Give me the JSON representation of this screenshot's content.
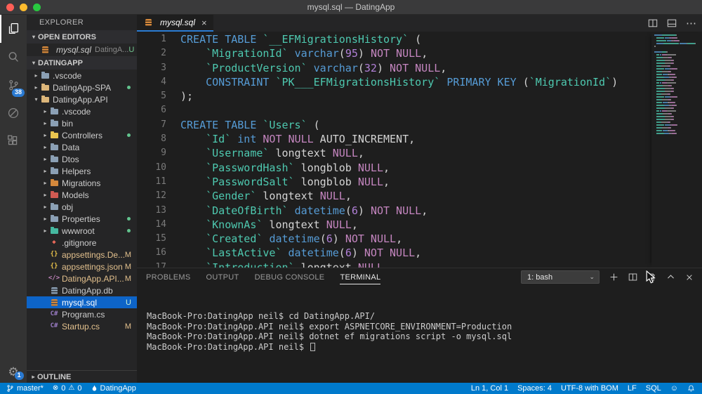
{
  "window": {
    "title": "mysql.sql — DatingApp"
  },
  "activity_bar": {
    "items": [
      {
        "name": "explorer",
        "active": true
      },
      {
        "name": "search"
      },
      {
        "name": "source-control",
        "badge": "38"
      },
      {
        "name": "debug"
      },
      {
        "name": "extensions"
      }
    ],
    "manage": {
      "name": "manage",
      "badge": "1"
    }
  },
  "sidebar": {
    "title": "EXPLORER",
    "open_editors": {
      "header": "OPEN EDITORS",
      "files": [
        {
          "label": "mysql.sql",
          "detail": "DatingA...",
          "badge": "U"
        }
      ]
    },
    "project": {
      "header": "DATINGAPP"
    },
    "outline": {
      "header": "OUTLINE"
    },
    "tree": [
      {
        "label": ".vscode",
        "level": 0,
        "chevron": "collapsed",
        "icon": "folder",
        "icon_color": "#8ba0b5"
      },
      {
        "label": "DatingApp-SPA",
        "level": 0,
        "chevron": "collapsed",
        "icon": "folder",
        "icon_color": "#dcb67a",
        "dot": true
      },
      {
        "label": "DatingApp.API",
        "level": 0,
        "chevron": "expanded",
        "icon": "folder",
        "icon_color": "#dcb67a"
      },
      {
        "label": ".vscode",
        "level": 1,
        "chevron": "collapsed",
        "icon": "folder",
        "icon_color": "#8ba0b5"
      },
      {
        "label": "bin",
        "level": 1,
        "chevron": "collapsed",
        "icon": "folder",
        "icon_color": "#8ba0b5"
      },
      {
        "label": "Controllers",
        "level": 1,
        "chevron": "collapsed",
        "icon": "folder",
        "icon_color": "#eac54f",
        "dot": true
      },
      {
        "label": "Data",
        "level": 1,
        "chevron": "collapsed",
        "icon": "folder",
        "icon_color": "#8ba0b5"
      },
      {
        "label": "Dtos",
        "level": 1,
        "chevron": "collapsed",
        "icon": "folder",
        "icon_color": "#8ba0b5"
      },
      {
        "label": "Helpers",
        "level": 1,
        "chevron": "collapsed",
        "icon": "folder",
        "icon_color": "#8ba0b5"
      },
      {
        "label": "Migrations",
        "level": 1,
        "chevron": "collapsed",
        "icon": "folder",
        "icon_color": "#d4883c"
      },
      {
        "label": "Models",
        "level": 1,
        "chevron": "collapsed",
        "icon": "folder",
        "icon_color": "#d05a52"
      },
      {
        "label": "obj",
        "level": 1,
        "chevron": "collapsed",
        "icon": "folder",
        "icon_color": "#8ba0b5"
      },
      {
        "label": "Properties",
        "level": 1,
        "chevron": "collapsed",
        "icon": "folder",
        "icon_color": "#8ba0b5",
        "dot": true
      },
      {
        "label": "wwwroot",
        "level": 1,
        "chevron": "collapsed",
        "icon": "folder",
        "icon_color": "#45b8a0",
        "dot": true
      },
      {
        "label": ".gitignore",
        "level": 1,
        "icon": "diamond",
        "icon_color": "#e8695a"
      },
      {
        "label": "appsettings.De...",
        "level": 1,
        "icon": "braces",
        "icon_color": "#e8c24a",
        "badge": "M",
        "badge_color": "#E2C08D",
        "label_color": "#E2C08D"
      },
      {
        "label": "appsettings.json",
        "level": 1,
        "icon": "braces",
        "icon_color": "#e8c24a",
        "badge": "M",
        "badge_color": "#E2C08D",
        "label_color": "#E2C08D"
      },
      {
        "label": "DatingApp.API...",
        "level": 1,
        "icon": "code",
        "icon_color": "#c586c0",
        "badge": "M",
        "badge_color": "#E2C08D",
        "label_color": "#E2C08D"
      },
      {
        "label": "DatingApp.db",
        "level": 1,
        "icon": "database",
        "icon_color": "#8ba0b5"
      },
      {
        "label": "mysql.sql",
        "level": 1,
        "icon": "database",
        "icon_color": "#d4883c",
        "badge": "U",
        "badge_color": "#c9f0d6",
        "selected": true,
        "label_color": "#ffffff"
      },
      {
        "label": "Program.cs",
        "level": 1,
        "icon": "csharp",
        "icon_color": "#9b7cc6"
      },
      {
        "label": "Startup.cs",
        "level": 1,
        "icon": "csharp",
        "icon_color": "#9b7cc6",
        "badge": "M",
        "badge_color": "#E2C08D",
        "label_color": "#E2C08D"
      }
    ]
  },
  "editor": {
    "tabs": [
      {
        "label": "mysql.sql",
        "active": true,
        "icon": "database"
      }
    ],
    "code_lines": [
      {
        "num": 1,
        "tokens": [
          [
            "CREATE TABLE ",
            "kw"
          ],
          [
            "`__EFMigrationsHistory`",
            "ent"
          ],
          [
            " (",
            "pln"
          ]
        ]
      },
      {
        "num": 2,
        "tokens": [
          [
            "    ",
            "pln"
          ],
          [
            "`MigrationId`",
            "ent"
          ],
          [
            " ",
            "pln"
          ],
          [
            "varchar",
            "kw"
          ],
          [
            "(",
            "pln"
          ],
          [
            "95",
            "num"
          ],
          [
            ") ",
            "pln"
          ],
          [
            "NOT NULL",
            "op"
          ],
          [
            ",",
            "pln"
          ]
        ]
      },
      {
        "num": 3,
        "tokens": [
          [
            "    ",
            "pln"
          ],
          [
            "`ProductVersion`",
            "ent"
          ],
          [
            " ",
            "pln"
          ],
          [
            "varchar",
            "kw"
          ],
          [
            "(",
            "pln"
          ],
          [
            "32",
            "num"
          ],
          [
            ") ",
            "pln"
          ],
          [
            "NOT NULL",
            "op"
          ],
          [
            ",",
            "pln"
          ]
        ]
      },
      {
        "num": 4,
        "tokens": [
          [
            "    ",
            "pln"
          ],
          [
            "CONSTRAINT ",
            "kw"
          ],
          [
            "`PK___EFMigrationsHistory`",
            "ent"
          ],
          [
            " ",
            "pln"
          ],
          [
            "PRIMARY KEY ",
            "kw"
          ],
          [
            "(",
            "pln"
          ],
          [
            "`MigrationId`",
            "ent"
          ],
          [
            ")",
            "pln"
          ]
        ]
      },
      {
        "num": 5,
        "tokens": [
          [
            ");",
            "pln"
          ]
        ]
      },
      {
        "num": 6,
        "tokens": []
      },
      {
        "num": 7,
        "tokens": [
          [
            "CREATE TABLE ",
            "kw"
          ],
          [
            "`Users`",
            "ent"
          ],
          [
            " (",
            "pln"
          ]
        ]
      },
      {
        "num": 8,
        "tokens": [
          [
            "    ",
            "pln"
          ],
          [
            "`Id`",
            "ent"
          ],
          [
            " ",
            "pln"
          ],
          [
            "int",
            "kw"
          ],
          [
            " ",
            "pln"
          ],
          [
            "NOT NULL",
            "op"
          ],
          [
            " AUTO_INCREMENT,",
            "pln"
          ]
        ]
      },
      {
        "num": 9,
        "tokens": [
          [
            "    ",
            "pln"
          ],
          [
            "`Username`",
            "ent"
          ],
          [
            " longtext ",
            "pln"
          ],
          [
            "NULL",
            "op"
          ],
          [
            ",",
            "pln"
          ]
        ]
      },
      {
        "num": 10,
        "tokens": [
          [
            "    ",
            "pln"
          ],
          [
            "`PasswordHash`",
            "ent"
          ],
          [
            " longblob ",
            "pln"
          ],
          [
            "NULL",
            "op"
          ],
          [
            ",",
            "pln"
          ]
        ]
      },
      {
        "num": 11,
        "tokens": [
          [
            "    ",
            "pln"
          ],
          [
            "`PasswordSalt`",
            "ent"
          ],
          [
            " longblob ",
            "pln"
          ],
          [
            "NULL",
            "op"
          ],
          [
            ",",
            "pln"
          ]
        ]
      },
      {
        "num": 12,
        "tokens": [
          [
            "    ",
            "pln"
          ],
          [
            "`Gender`",
            "ent"
          ],
          [
            " longtext ",
            "pln"
          ],
          [
            "NULL",
            "op"
          ],
          [
            ",",
            "pln"
          ]
        ]
      },
      {
        "num": 13,
        "tokens": [
          [
            "    ",
            "pln"
          ],
          [
            "`DateOfBirth`",
            "ent"
          ],
          [
            " ",
            "pln"
          ],
          [
            "datetime",
            "kw"
          ],
          [
            "(",
            "pln"
          ],
          [
            "6",
            "num"
          ],
          [
            ") ",
            "pln"
          ],
          [
            "NOT NULL",
            "op"
          ],
          [
            ",",
            "pln"
          ]
        ]
      },
      {
        "num": 14,
        "tokens": [
          [
            "    ",
            "pln"
          ],
          [
            "`KnownAs`",
            "ent"
          ],
          [
            " longtext ",
            "pln"
          ],
          [
            "NULL",
            "op"
          ],
          [
            ",",
            "pln"
          ]
        ]
      },
      {
        "num": 15,
        "tokens": [
          [
            "    ",
            "pln"
          ],
          [
            "`Created`",
            "ent"
          ],
          [
            " ",
            "pln"
          ],
          [
            "datetime",
            "kw"
          ],
          [
            "(",
            "pln"
          ],
          [
            "6",
            "num"
          ],
          [
            ") ",
            "pln"
          ],
          [
            "NOT NULL",
            "op"
          ],
          [
            ",",
            "pln"
          ]
        ]
      },
      {
        "num": 16,
        "tokens": [
          [
            "    ",
            "pln"
          ],
          [
            "`LastActive`",
            "ent"
          ],
          [
            " ",
            "pln"
          ],
          [
            "datetime",
            "kw"
          ],
          [
            "(",
            "pln"
          ],
          [
            "6",
            "num"
          ],
          [
            ") ",
            "pln"
          ],
          [
            "NOT NULL",
            "op"
          ],
          [
            ",",
            "pln"
          ]
        ]
      },
      {
        "num": 17,
        "tokens": [
          [
            "    ",
            "pln"
          ],
          [
            "`Introduction`",
            "ent"
          ],
          [
            " longtext ",
            "pln"
          ],
          [
            "NULL",
            "op"
          ],
          [
            ",",
            "pln"
          ]
        ]
      }
    ]
  },
  "panel": {
    "tabs": [
      {
        "label": "PROBLEMS"
      },
      {
        "label": "OUTPUT"
      },
      {
        "label": "DEBUG CONSOLE"
      },
      {
        "label": "TERMINAL",
        "active": true
      }
    ],
    "shell_selector": "1: bash",
    "terminal": {
      "lines": [
        "MacBook-Pro:DatingApp neil$ cd DatingApp.API/",
        "MacBook-Pro:DatingApp.API neil$ export ASPNETCORE_ENVIRONMENT=Production",
        "MacBook-Pro:DatingApp.API neil$ dotnet ef migrations script -o mysql.sql",
        "MacBook-Pro:DatingApp.API neil$ "
      ],
      "cursor": true
    }
  },
  "status_bar": {
    "branch": "master*",
    "errors": "0",
    "warnings": "0",
    "app": "DatingApp",
    "cursor_position": "Ln 1, Col 1",
    "indentation": "Spaces: 4",
    "encoding": "UTF-8 with BOM",
    "eol": "LF",
    "language": "SQL"
  },
  "colors": {
    "status_bar_bg": "#007acc",
    "selection_bg": "#0d64c8",
    "keyword": "#569cd6",
    "identifier": "#4ec9b0",
    "number": "#b180d7",
    "null_keyword": "#c586c0",
    "git_modified": "#E2C08D",
    "git_untracked": "#73C991"
  }
}
